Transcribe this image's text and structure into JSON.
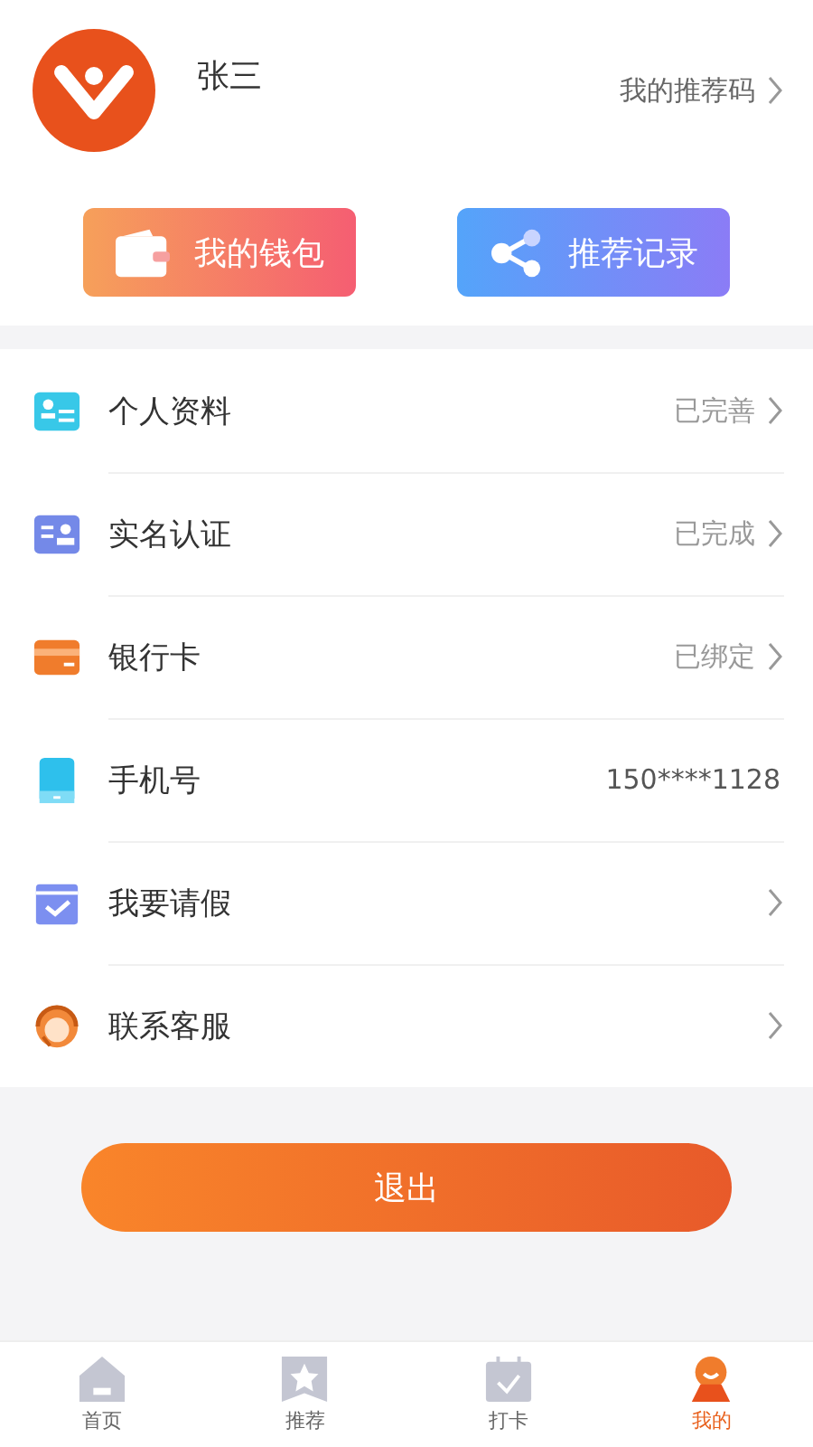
{
  "profile": {
    "name": "张三",
    "referral_link": "我的推荐码"
  },
  "actions": [
    {
      "kind": "wallet",
      "label": "我的钱包"
    },
    {
      "kind": "share",
      "label": "推荐记录"
    }
  ],
  "menu": [
    {
      "kind": "profile",
      "label": "个人资料",
      "value": "已完善",
      "chevron": true
    },
    {
      "kind": "id",
      "label": "实名认证",
      "value": "已完成",
      "chevron": true
    },
    {
      "kind": "card",
      "label": "银行卡",
      "value": "已绑定",
      "chevron": true
    },
    {
      "kind": "phone",
      "label": "手机号",
      "value": "150****1128",
      "chevron": false
    },
    {
      "kind": "leave",
      "label": "我要请假",
      "chevron": true
    },
    {
      "kind": "service",
      "label": "联系客服",
      "chevron": true
    }
  ],
  "logout": "退出",
  "tabs": [
    {
      "kind": "home",
      "label": "首页",
      "selected": false
    },
    {
      "kind": "star",
      "label": "推荐",
      "selected": false
    },
    {
      "kind": "checkin",
      "label": "打卡",
      "selected": false
    },
    {
      "kind": "me",
      "label": "我的",
      "selected": true
    }
  ]
}
